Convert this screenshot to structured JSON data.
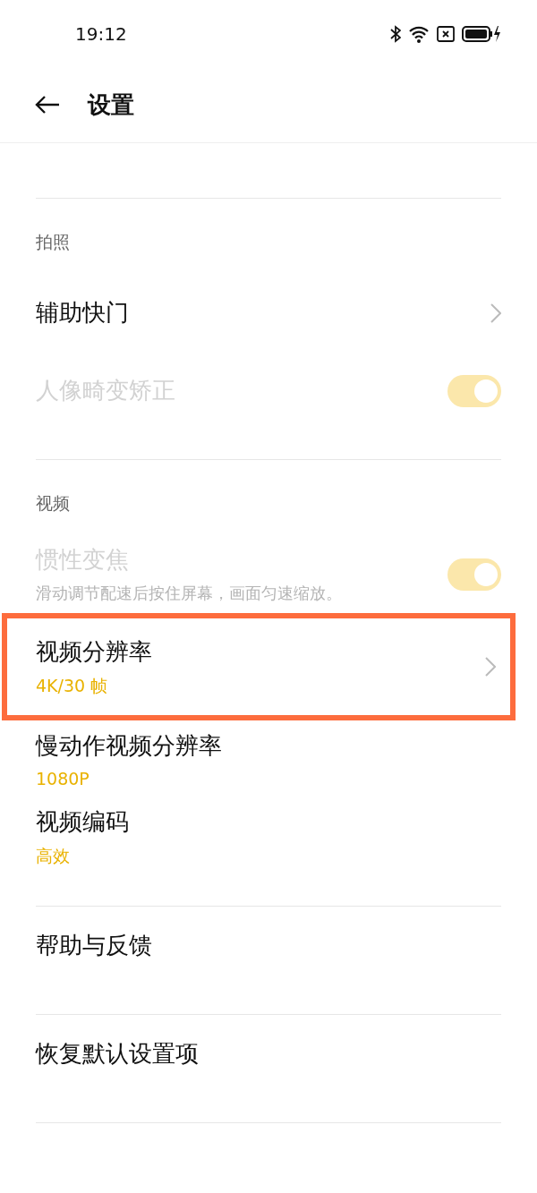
{
  "status_bar": {
    "time": "19:12"
  },
  "header": {
    "title": "设置"
  },
  "items": [
    {
      "kind": "divider"
    },
    {
      "kind": "section",
      "title": "拍照"
    },
    {
      "kind": "nav",
      "title": "辅助快门"
    },
    {
      "kind": "toggle",
      "title": "人像畸变矫正",
      "on": true,
      "disabled": true
    },
    {
      "kind": "divider"
    },
    {
      "kind": "section",
      "title": "视频"
    },
    {
      "kind": "toggle",
      "title": "惯性变焦",
      "subtitle": "滑动调节配速后按住屏幕，画面匀速缩放。",
      "on": true,
      "disabled": true
    },
    {
      "kind": "nav",
      "title": "视频分辨率",
      "value": "4K/30 帧",
      "highlighted": true
    },
    {
      "kind": "entry",
      "title": "慢动作视频分辨率",
      "value": "1080P"
    },
    {
      "kind": "entry",
      "title": "视频编码",
      "value": "高效"
    },
    {
      "kind": "divider"
    },
    {
      "kind": "entry",
      "title": "帮助与反馈"
    },
    {
      "kind": "divider"
    },
    {
      "kind": "entry",
      "title": "恢复默认设置项"
    },
    {
      "kind": "divider"
    }
  ]
}
